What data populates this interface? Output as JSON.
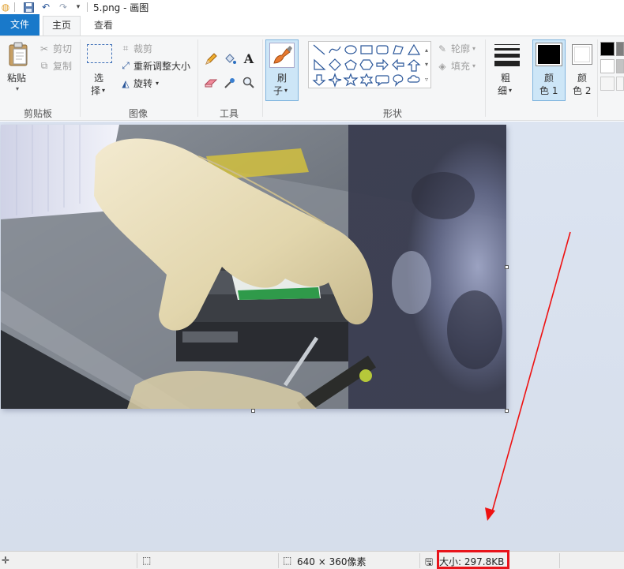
{
  "window": {
    "title": "5.png - 画图"
  },
  "tabs": [
    {
      "label": "文件"
    },
    {
      "label": "主页"
    },
    {
      "label": "查看"
    }
  ],
  "ribbon": {
    "clipboard": {
      "paste_label": "粘贴",
      "cut_label": "剪切",
      "copy_label": "复制",
      "group_label": "剪贴板"
    },
    "image": {
      "select_label_1": "选",
      "select_label_2": "择",
      "crop_label": "裁剪",
      "resize_label": "重新调整大小",
      "rotate_label": "旋转",
      "group_label": "图像"
    },
    "tools": {
      "group_label": "工具",
      "text_glyph": "A"
    },
    "brushes": {
      "label_1": "刷",
      "label_2": "子"
    },
    "shapes": {
      "outline_label": "轮廓",
      "fill_label": "填充",
      "group_label": "形状"
    },
    "size": {
      "label_1": "粗",
      "label_2": "细"
    },
    "color1": {
      "label_1": "颜",
      "label_2": "色 1",
      "value": "#000000"
    },
    "color2": {
      "label_1": "颜",
      "label_2": "色 2",
      "value": "#ffffff"
    }
  },
  "statusbar": {
    "dimensions": "640 × 360像素",
    "size": "大小: 297.8KB"
  },
  "colors": {
    "accent": "#1979ca",
    "highlight": "#e8141b",
    "arrow": "#ee1111"
  }
}
